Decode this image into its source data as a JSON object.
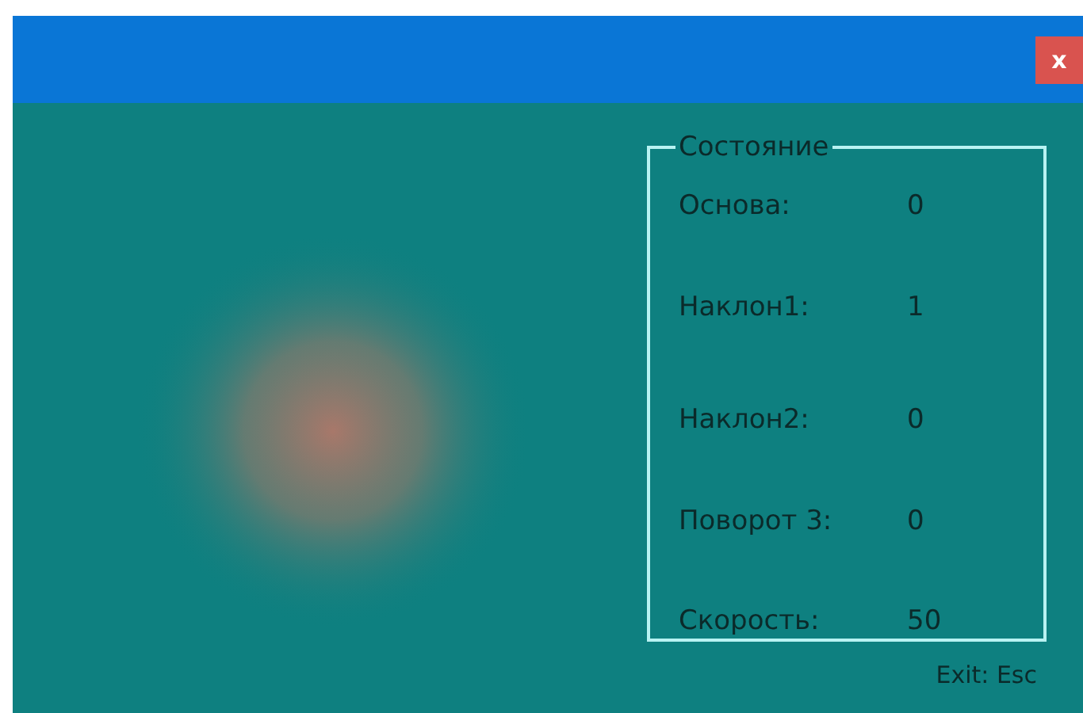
{
  "title_bar": {
    "close": "x"
  },
  "status": {
    "legend": "Состояние",
    "rows": [
      {
        "label": "Основа:",
        "value": "0"
      },
      {
        "label": "Наклон1:",
        "value": "1"
      },
      {
        "label": "Наклон2:",
        "value": "0"
      },
      {
        "label": "Поворот 3:",
        "value": "0"
      },
      {
        "label": "Скорость:",
        "value": "50"
      }
    ]
  },
  "hint": "Exit: Esc"
}
